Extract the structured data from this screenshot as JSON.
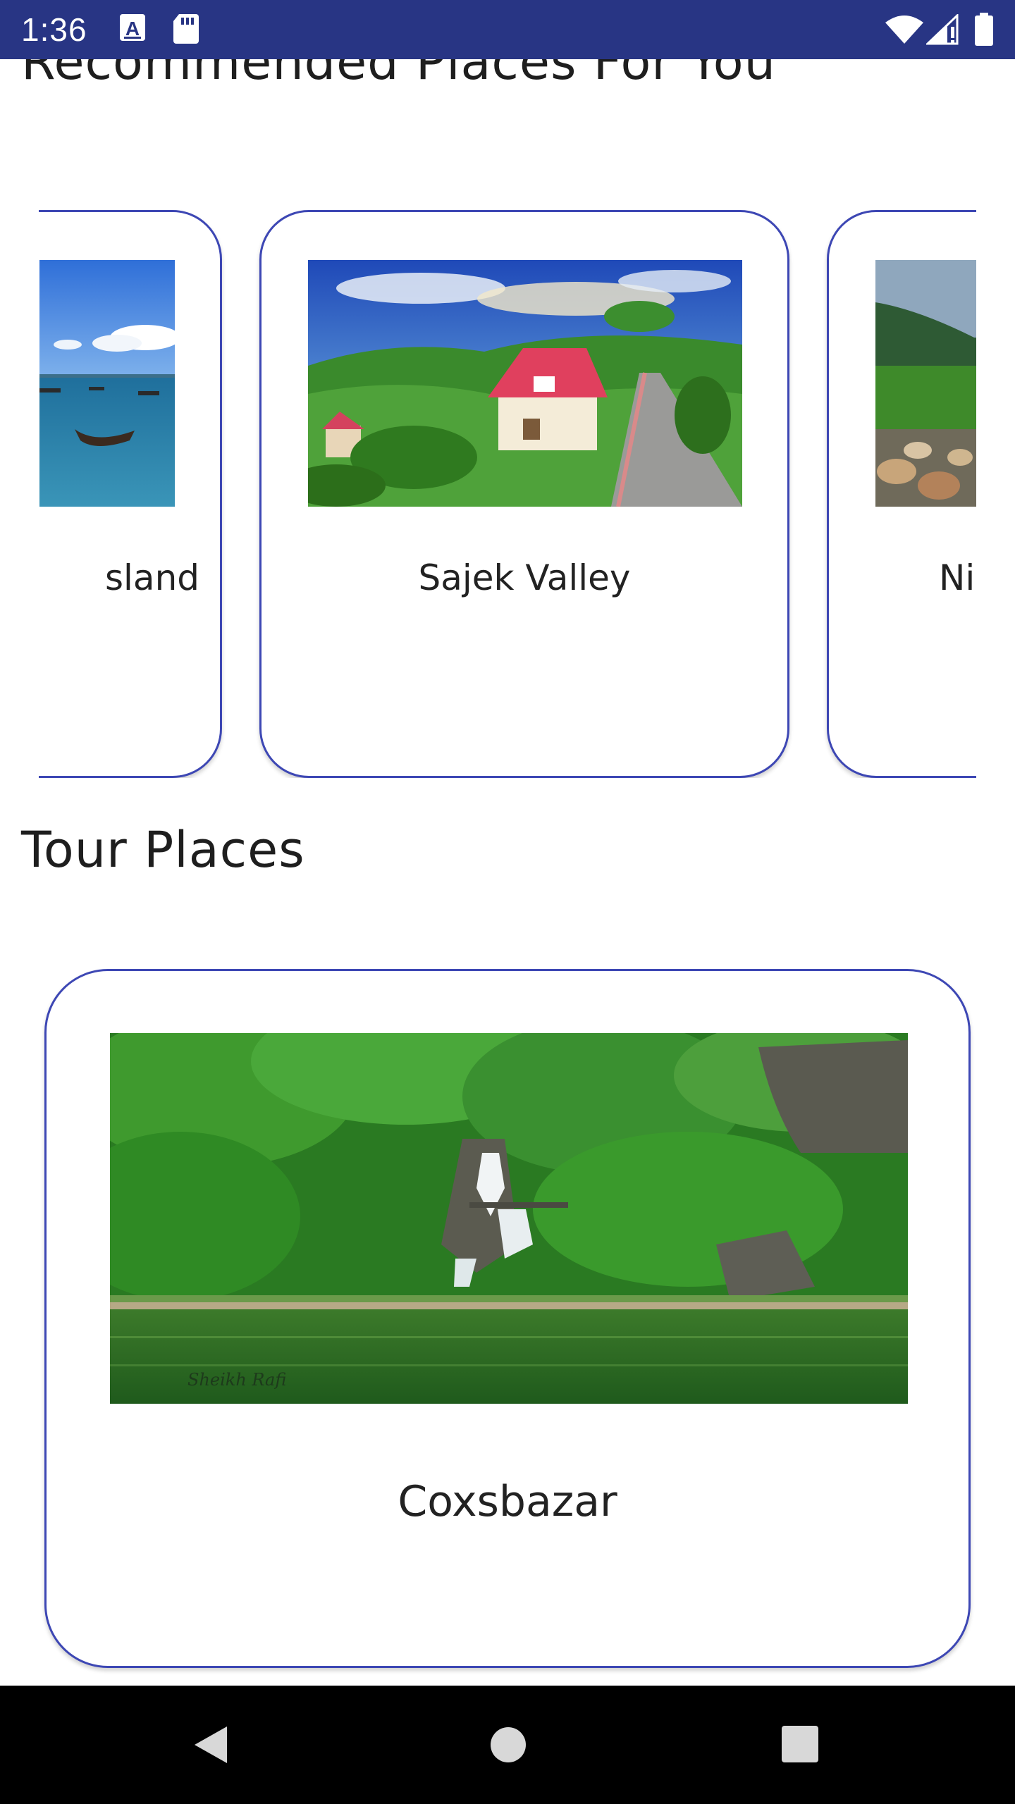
{
  "status_bar": {
    "time": "1:36",
    "icons": [
      "font-a-icon",
      "sd-card-icon",
      "wifi-icon",
      "cell-signal-icon",
      "battery-icon"
    ]
  },
  "recommended": {
    "title": "Recommended Places For You",
    "cards": [
      {
        "label": "sland",
        "image": "boats-sea-photo"
      },
      {
        "label": "Sajek Valley",
        "image": "red-roof-house-hill-photo"
      },
      {
        "label": "Ni",
        "image": "rocky-river-forest-photo"
      }
    ]
  },
  "tour_places": {
    "title": "Tour Places",
    "cards": [
      {
        "label": "Coxsbazar",
        "image": "waterfall-lake-forest-photo",
        "watermark": "Sheikh Rafi"
      }
    ]
  },
  "nav_bar": {
    "buttons": [
      "back-icon",
      "home-icon",
      "recents-icon"
    ]
  },
  "colors": {
    "status_bar": "#283584",
    "card_border": "#3d47b4",
    "nav_bar": "#000000"
  }
}
